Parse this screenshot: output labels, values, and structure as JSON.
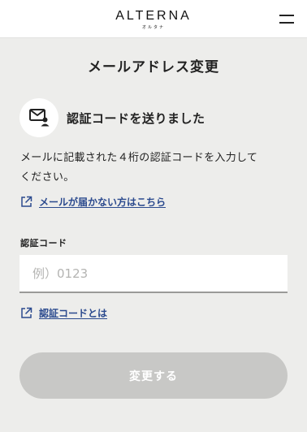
{
  "header": {
    "logo_main": "ALTERNA",
    "logo_sub": "オルタナ",
    "menu_icon": "hamburger-icon"
  },
  "page": {
    "title": "メールアドレス変更"
  },
  "notice": {
    "icon": "mail-notification-icon",
    "title": "認証コードを送りました",
    "body_line1": "メールに記載された４桁の認証コードを入力して",
    "body_line2": "ください。"
  },
  "links": {
    "mail_not_arrived": "メールが届かない方はこちら",
    "what_is_code": "認証コードとは",
    "icon": "external-link-icon"
  },
  "form": {
    "code_label": "認証コード",
    "code_placeholder": "例）0123",
    "code_value": "",
    "submit_label": "変更する"
  },
  "colors": {
    "background": "#ededeb",
    "link": "#2b4a8e",
    "button_disabled": "#c8c8c6"
  }
}
